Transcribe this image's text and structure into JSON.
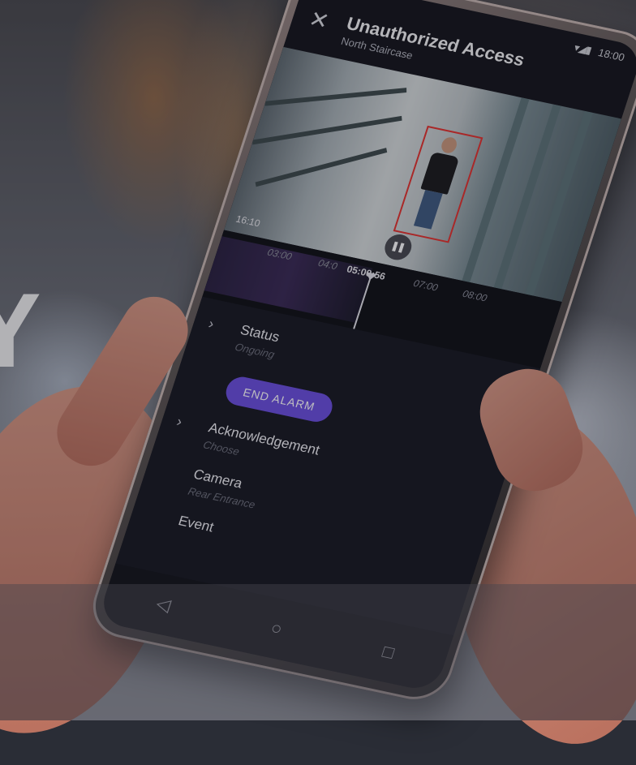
{
  "background": {
    "text": "Y"
  },
  "status_bar": {
    "signal": "▾◢▮",
    "time": "18:00"
  },
  "alarm": {
    "title": "Unauthorized Access",
    "subtitle": "North Staircase"
  },
  "player": {
    "time_left": "16:10",
    "timeline_ticks": [
      "03:00",
      "04:0",
      "05:00:56",
      "07:00",
      "08:00"
    ],
    "current_time": "05:00:56"
  },
  "details": {
    "status_label": "Status",
    "status_value": "Ongoing",
    "end_alarm_label": "END ALARM",
    "acknowledgement_label": "Acknowledgement",
    "acknowledgement_value": "Choose",
    "camera_label": "Camera",
    "camera_value": "Rear Entrance",
    "event_label": "Event"
  },
  "colors": {
    "accent": "#6b4fe0",
    "bbox": "#e5322e",
    "screen": "#15161c"
  },
  "icons": [
    "close-icon",
    "pause-icon",
    "chevron-right-icon",
    "back-icon",
    "home-icon",
    "recents-icon"
  ]
}
